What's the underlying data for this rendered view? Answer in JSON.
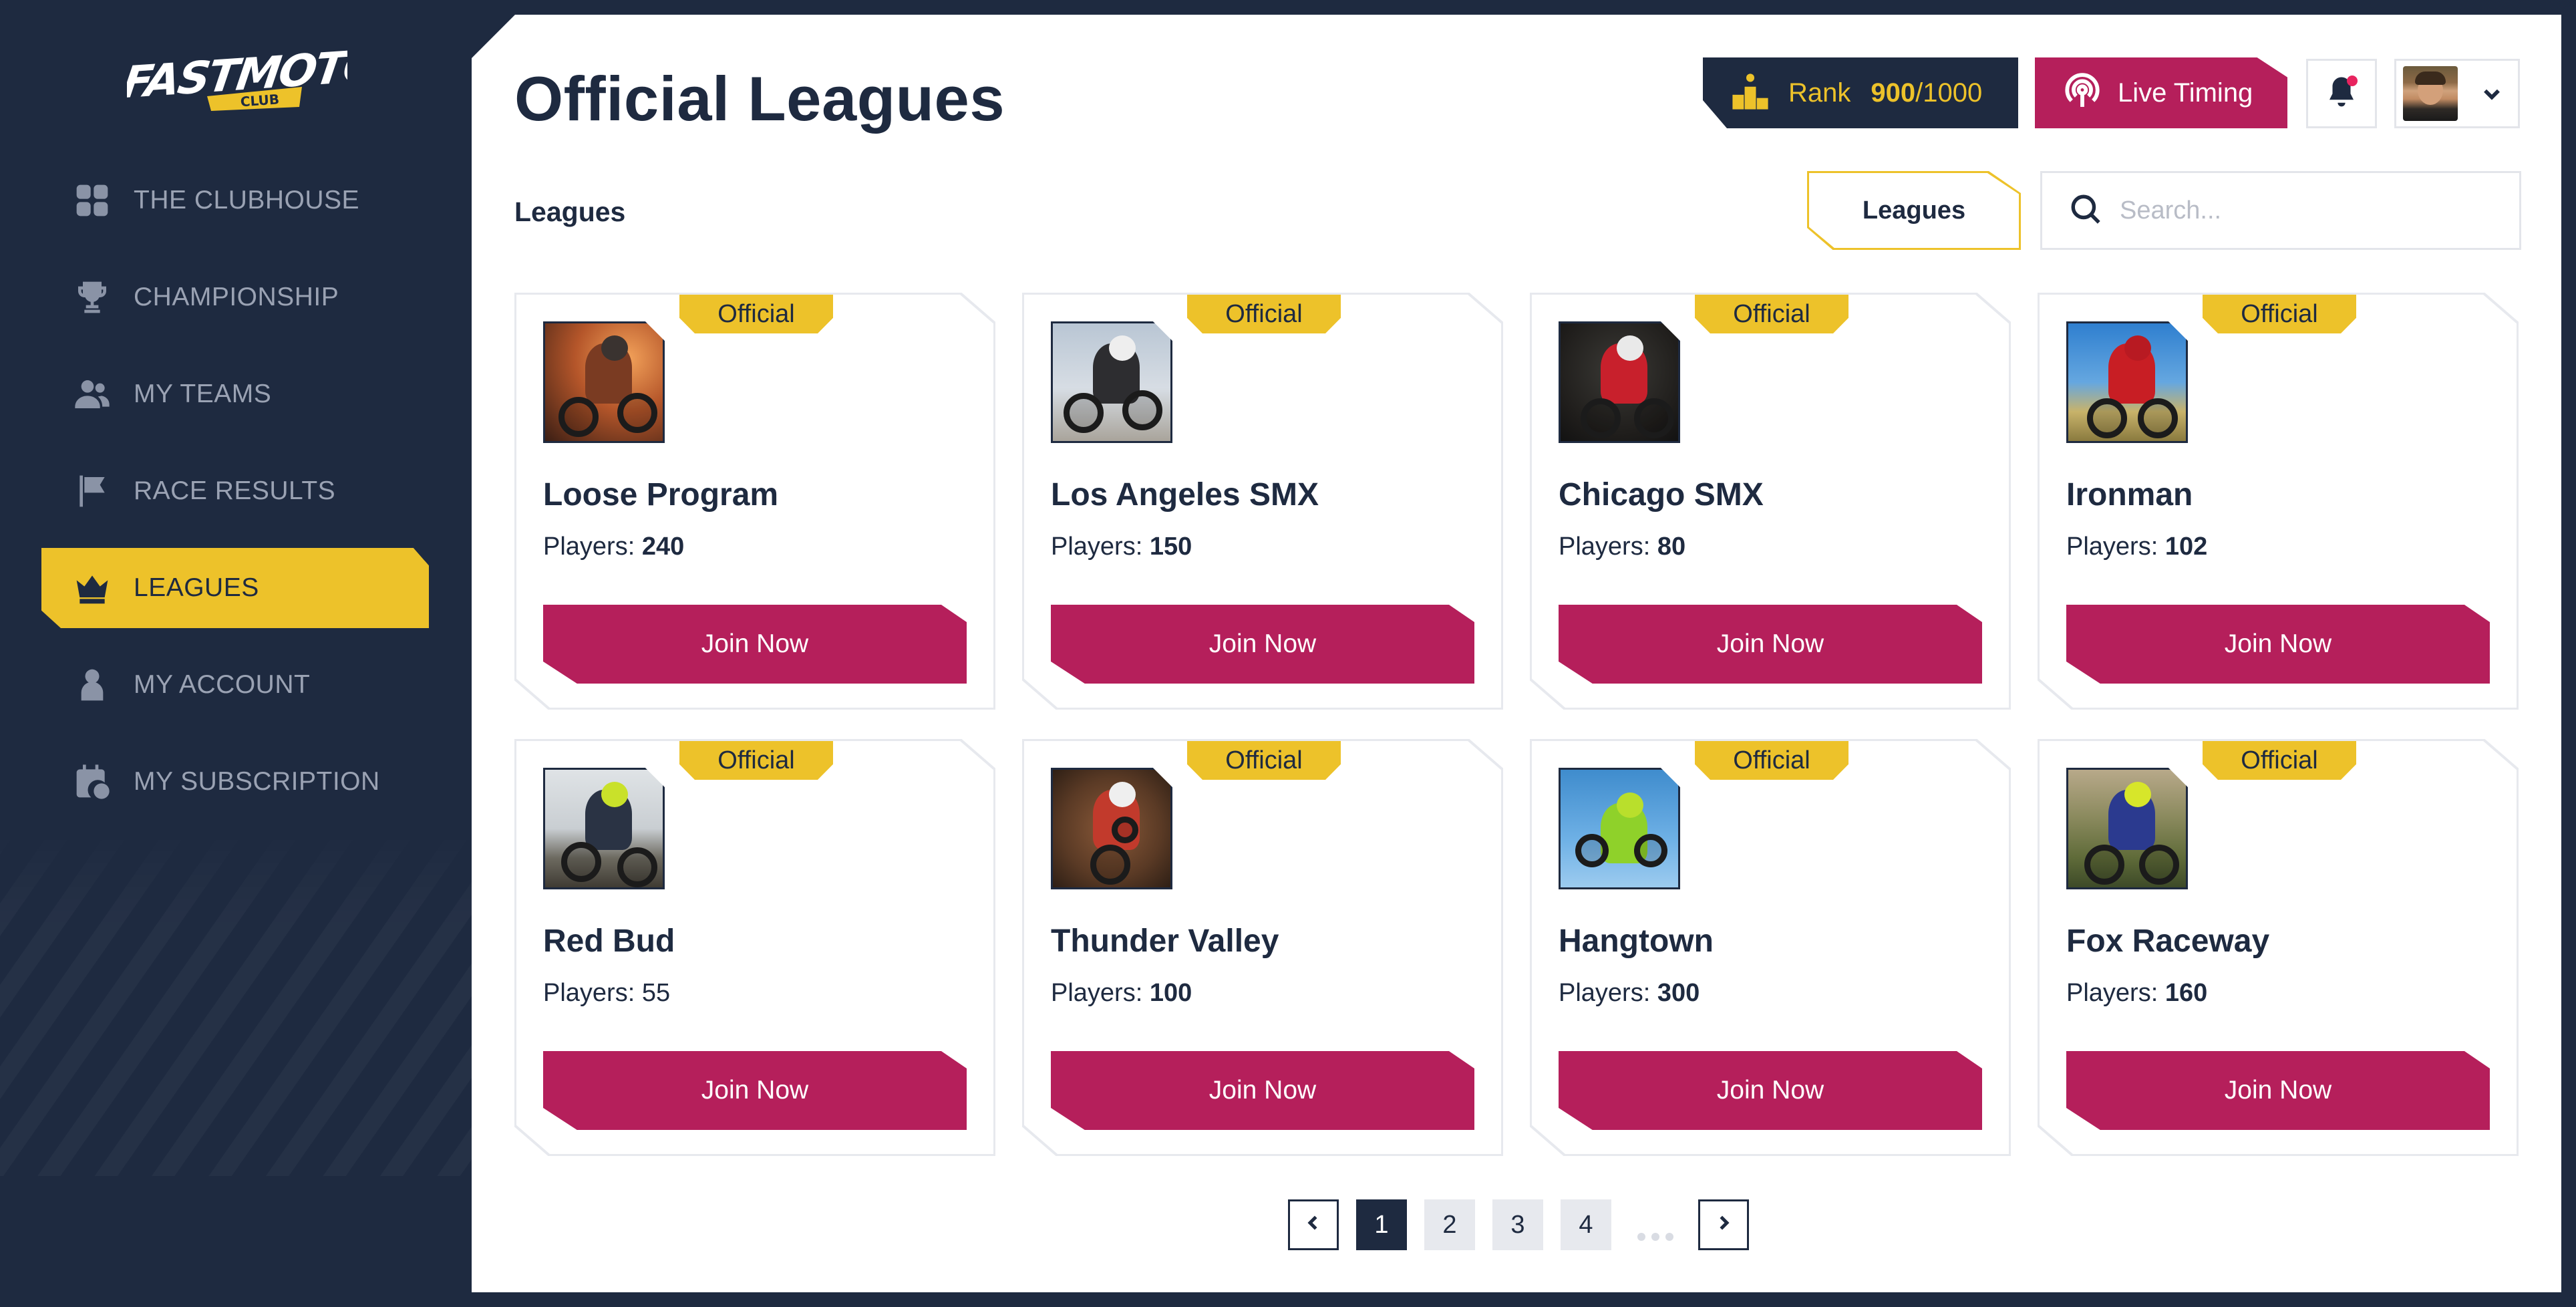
{
  "brand": {
    "logo_text": "FASTMOTO",
    "logo_sub": "CLUB",
    "accent": "#edc22a",
    "primary": "#b51f5b",
    "navy": "#1e2a40"
  },
  "sidebar": {
    "items": [
      {
        "label": "THE CLUBHOUSE",
        "icon": "grid-icon",
        "active": false
      },
      {
        "label": "CHAMPIONSHIP",
        "icon": "trophy-icon",
        "active": false
      },
      {
        "label": "MY TEAMS",
        "icon": "users-icon",
        "active": false
      },
      {
        "label": "RACE RESULTS",
        "icon": "flag-icon",
        "active": false
      },
      {
        "label": "LEAGUES",
        "icon": "crown-icon",
        "active": true
      },
      {
        "label": "MY ACCOUNT",
        "icon": "user-icon",
        "active": false
      },
      {
        "label": "MY SUBSCRIPTION",
        "icon": "calendar-icon",
        "active": false
      }
    ]
  },
  "header": {
    "title": "Official Leagues",
    "rank_label": "Rank",
    "rank_value": "900",
    "rank_sep": "/",
    "rank_max": "1000",
    "live_label": "Live Timing"
  },
  "toolbar": {
    "section_label": "Leagues",
    "filter_label": "Leagues",
    "search_placeholder": "Search..."
  },
  "cards": [
    {
      "badge": "Official",
      "title": "Loose Program",
      "players_label": "Players:",
      "players": "240",
      "button": "Join Now"
    },
    {
      "badge": "Official",
      "title": "Los Angeles SMX",
      "players_label": "Players:",
      "players": "150",
      "button": "Join Now"
    },
    {
      "badge": "Official",
      "title": "Chicago SMX",
      "players_label": "Players:",
      "players": "80",
      "button": "Join Now"
    },
    {
      "badge": "Official",
      "title": "Ironman",
      "players_label": "Players:",
      "players": "102",
      "button": "Join Now"
    },
    {
      "badge": "Official",
      "title": "Red Bud",
      "players_label": "Players:",
      "players": "55",
      "button": "Join Now"
    },
    {
      "badge": "Official",
      "title": "Thunder Valley",
      "players_label": "Players:",
      "players": "100",
      "button": "Join Now"
    },
    {
      "badge": "Official",
      "title": "Hangtown",
      "players_label": "Players:",
      "players": "300",
      "button": "Join Now"
    },
    {
      "badge": "Official",
      "title": "Fox Raceway",
      "players_label": "Players:",
      "players": "160",
      "button": "Join Now"
    }
  ],
  "pagination": {
    "pages": [
      "1",
      "2",
      "3",
      "4"
    ],
    "current": "1"
  }
}
